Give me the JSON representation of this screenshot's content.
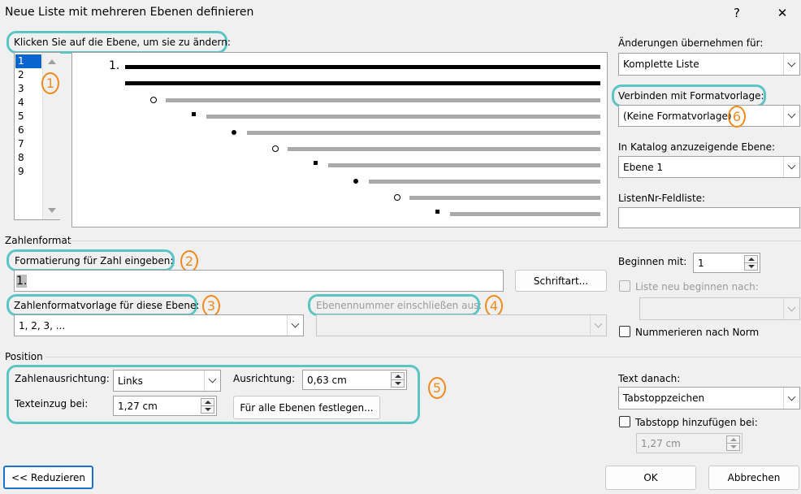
{
  "dialog": {
    "title": "Neue Liste mit mehreren Ebenen definieren",
    "help": "?",
    "close": "✕"
  },
  "levels": {
    "label": "Klicken Sie auf die Ebene, um sie zu ändern:",
    "items": [
      "1",
      "2",
      "3",
      "4",
      "5",
      "6",
      "7",
      "8",
      "9"
    ],
    "selected": "1"
  },
  "preview": {
    "number": "1."
  },
  "apply": {
    "label": "Änderungen übernehmen für:",
    "value": "Komplette Liste"
  },
  "link_style": {
    "label": "Verbinden mit Formatvorlage:",
    "value": "(Keine Formatvorlage)"
  },
  "gallery_level": {
    "label": "In Katalog anzuzeigende Ebene:",
    "value": "Ebene 1"
  },
  "listnum": {
    "label": "ListenNr-Feldliste:",
    "value": ""
  },
  "number_format": {
    "section": "Zahlenformat",
    "format_label": "Formatierung für Zahl eingeben:",
    "format_value": "1.",
    "font_button": "Schriftart...",
    "style_label": "Zahlenformatvorlage für diese Ebene:",
    "style_value": "1, 2, 3, ...",
    "include_label": "Ebenennummer einschließen aus:",
    "include_value": "",
    "start_label": "Beginnen mit:",
    "start_value": "1",
    "restart_label": "Liste neu beginnen nach:",
    "restart_value": "",
    "legal_label": "Nummerieren nach Norm"
  },
  "position": {
    "section": "Position",
    "align_label": "Zahlenausrichtung:",
    "align_value": "Links",
    "at_label": "Ausrichtung:",
    "at_value": "0,63 cm",
    "indent_label": "Texteinzug bei:",
    "indent_value": "1,27 cm",
    "set_all_button": "Für alle Ebenen festlegen...",
    "follow_label": "Text danach:",
    "follow_value": "Tabstoppzeichen",
    "tab_label": "Tabstopp hinzufügen bei:",
    "tab_value": "1,27 cm"
  },
  "footer": {
    "less_button": "<< Reduzieren",
    "ok_button": "OK",
    "cancel_button": "Abbrechen"
  },
  "callouts": [
    "1",
    "2",
    "3",
    "4",
    "5",
    "6"
  ],
  "colors": {
    "highlight": "#5bc5c5",
    "callout": "#f08a1c",
    "selection": "#0a64d0"
  }
}
